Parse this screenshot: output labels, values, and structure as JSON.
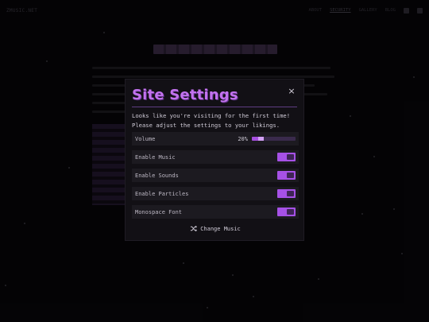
{
  "background": {
    "brand": "ZMUSIC.NET",
    "nav": [
      "ABOUT",
      "SECURITY",
      "GALLERY",
      "BLOG"
    ]
  },
  "modal": {
    "title": "Site Settings",
    "close_label": "×",
    "description_line1": "Looks like you're visiting for the first time!",
    "description_line2": "Please adjust the settings to your likings.",
    "volume": {
      "label": "Volume",
      "value_text": "20%",
      "level": 0.2
    },
    "toggles": [
      {
        "label": "Enable Music",
        "on": true
      },
      {
        "label": "Enable Sounds",
        "on": true
      },
      {
        "label": "Enable Particles",
        "on": true
      },
      {
        "label": "Monospace Font",
        "on": true
      }
    ],
    "change_music_label": "Change Music",
    "icons": {
      "close": "close-icon",
      "shuffle": "shuffle-icon"
    }
  },
  "colors": {
    "accent": "#a651e6",
    "title": "#c272ee",
    "modal_bg": "#121015",
    "row_bg": "#1c1a20",
    "page_bg": "#070609"
  }
}
